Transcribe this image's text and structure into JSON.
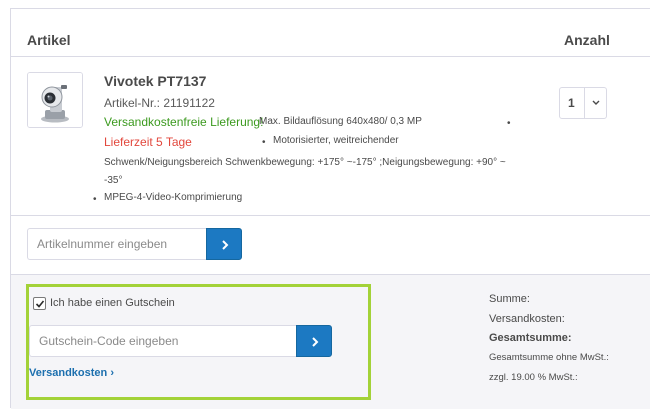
{
  "table_header": {
    "article": "Artikel",
    "quantity": "Anzahl"
  },
  "product": {
    "title": "Vivotek PT7137",
    "sku": "Artikel-Nr.: 21191122",
    "shipping_note": "Versandkostenfreie Lieferung!",
    "desc_line1": "Max. Bildauflösung 640x480/ 0,3 MP",
    "delivery_time": "Lieferzeit 5 Tage",
    "bullet": "•",
    "desc_line2": "Motorisierter, weitreichender",
    "desc_line3": "Schwenk/Neigungsbereich Schwenkbewegung: +175° ~-175° ;Neigungsbewegung: +90° ~ -35°",
    "desc_line4": "MPEG-4-Video-Komprimierung",
    "image_icon": "camera-product-image",
    "quantity": "1"
  },
  "add_article": {
    "placeholder": "Artikelnummer eingeben",
    "button_icon": "chevron-right-icon"
  },
  "voucher": {
    "checkbox_checked": true,
    "checkbox_label": "Ich habe einen Gutschein",
    "placeholder": "Gutschein-Code eingeben",
    "button_icon": "chevron-right-icon",
    "shipping_link": "Versandkosten ›"
  },
  "summary": {
    "sum_label": "Summe:",
    "shipping_label": "Versandkosten:",
    "total_label": "Gesamtsumme:",
    "net_label": "Gesamtsumme ohne MwSt.:",
    "vat_label": "zzgl. 19.00 % MwSt.:"
  },
  "colors": {
    "accent_blue": "#1c79c2",
    "link_blue": "#1c6fae",
    "success_green": "#3c9a1f",
    "warning_red": "#e2473c",
    "highlight_green": "#a3d238"
  }
}
